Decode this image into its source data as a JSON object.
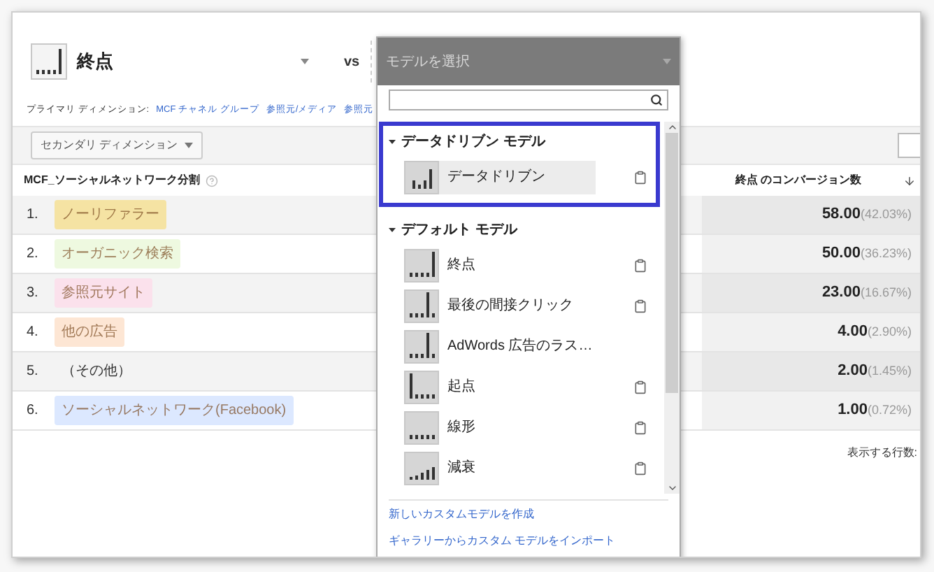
{
  "model_selector": {
    "label": "終点"
  },
  "vs": "vs",
  "primary_dimension": {
    "label": "プライマリ ディメンション:",
    "options": [
      "MCF チャネル グループ",
      "参照元/メディア",
      "参照元"
    ]
  },
  "secondary_dimension_button": {
    "label": "セカンダリ ディメンション"
  },
  "table": {
    "columns": [
      "MCF_ソーシャルネットワーク分割",
      "終点 のコンバージョン数"
    ],
    "rows": [
      {
        "rank": "1.",
        "channel": "ノーリファラー",
        "color": "#f5e3a3",
        "value": "58.00",
        "share": "(42.03%)"
      },
      {
        "rank": "2.",
        "channel": "オーガニック検索",
        "color": "#eef9e0",
        "value": "50.00",
        "share": "(36.23%)"
      },
      {
        "rank": "3.",
        "channel": "参照元サイト",
        "color": "#fbe1ec",
        "value": "23.00",
        "share": "(16.67%)"
      },
      {
        "rank": "4.",
        "channel": "他の広告",
        "color": "#fde6d4",
        "value": "4.00",
        "share": "(2.90%)"
      },
      {
        "rank": "5.",
        "channel": "（その他）",
        "color": null,
        "value": "2.00",
        "share": "(1.45%)"
      },
      {
        "rank": "6.",
        "channel": "ソーシャルネットワーク(Facebook)",
        "color": "#dce8ff",
        "value": "1.00",
        "share": "(0.72%)"
      }
    ]
  },
  "rows_label": "表示する行数:",
  "model_picker": {
    "title": "モデルを選択",
    "groups": [
      {
        "title": "データドリブン モデル",
        "expanded": true,
        "highlighted": true,
        "items": [
          {
            "label": "データドリブン",
            "selected": true,
            "copyable": true
          }
        ]
      },
      {
        "title": "デフォルト モデル",
        "expanded": true,
        "highlighted": false,
        "items": [
          {
            "label": "終点",
            "selected": false,
            "copyable": true
          },
          {
            "label": "最後の間接クリック",
            "selected": false,
            "copyable": true
          },
          {
            "label": "AdWords 広告のラス…",
            "selected": false,
            "copyable": false
          },
          {
            "label": "起点",
            "selected": false,
            "copyable": true
          },
          {
            "label": "線形",
            "selected": false,
            "copyable": true
          },
          {
            "label": "減衰",
            "selected": false,
            "copyable": true
          }
        ]
      }
    ],
    "links": [
      "新しいカスタムモデルを作成",
      "ギャラリーからカスタム モデルをインポート"
    ]
  }
}
